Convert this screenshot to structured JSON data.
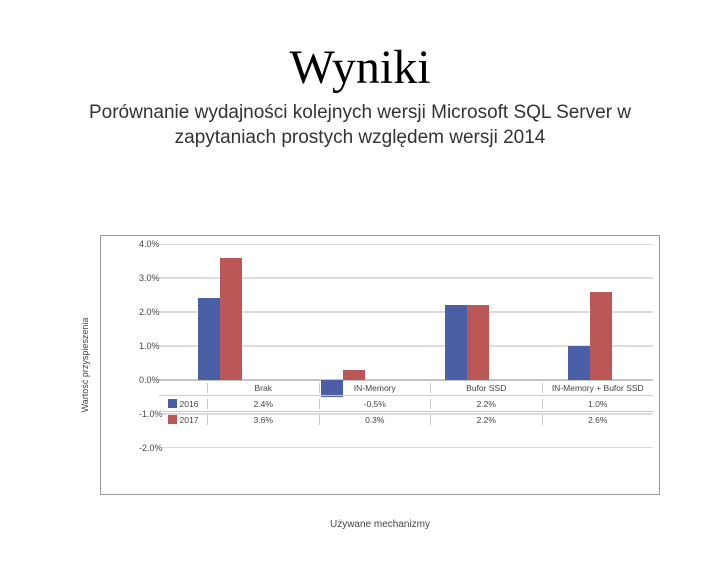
{
  "title": "Wyniki",
  "subtitle": "Porównanie wydajności kolejnych wersji Microsoft SQL Server w zapytaniach prostych względem wersji 2014",
  "ylabel": "Wartość przyspieszenia",
  "xlabel": "Używane mechanizmy",
  "ticks": [
    "4.0%",
    "3.0%",
    "2.0%",
    "1.0%",
    "0.0%",
    "-1.0%",
    "-2.0%"
  ],
  "legend": {
    "s1": "2016",
    "s2": "2017"
  },
  "categories": {
    "c0": "Brak",
    "c1": "IN-Memory",
    "c2": "Bufor SSD",
    "c3": "IN-Memory + Bufor SSD"
  },
  "cells": {
    "s1c0": "2.4%",
    "s1c1": "-0.5%",
    "s1c2": "2.2%",
    "s1c3": "1.0%",
    "s2c0": "3.6%",
    "s2c1": "0.3%",
    "s2c2": "2.2%",
    "s2c3": "2.6%"
  },
  "chart_data": {
    "type": "bar",
    "title": "Wyniki",
    "xlabel": "Używane mechanizmy",
    "ylabel": "Wartość przyspieszenia",
    "ylim": [
      -2.0,
      4.0
    ],
    "categories": [
      "Brak",
      "IN-Memory",
      "Bufor SSD",
      "IN-Memory + Bufor SSD"
    ],
    "series": [
      {
        "name": "2016",
        "values": [
          2.4,
          -0.5,
          2.2,
          1.0
        ]
      },
      {
        "name": "2017",
        "values": [
          3.6,
          0.3,
          2.2,
          2.6
        ]
      }
    ]
  }
}
